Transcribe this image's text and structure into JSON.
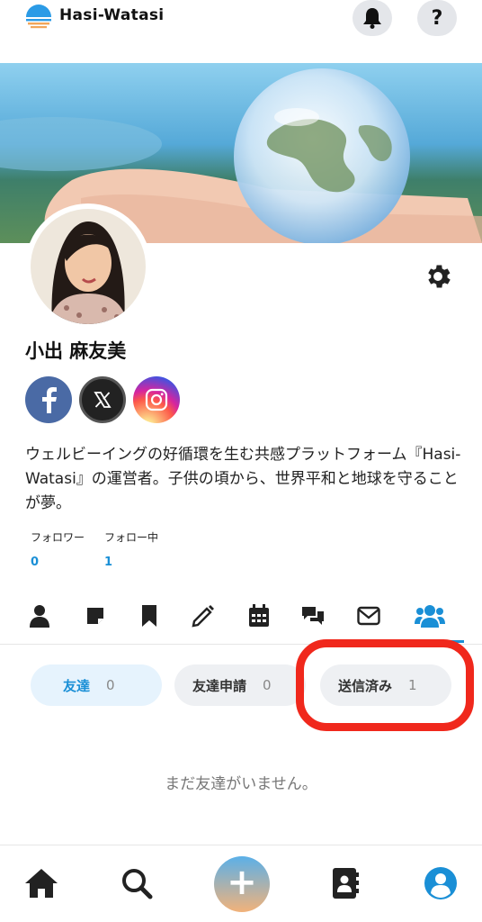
{
  "app": {
    "logo_text": "Hasi-Watasi"
  },
  "header": {
    "help_label": "?"
  },
  "profile": {
    "name": "小出 麻友美",
    "bio": "ウェルビーイングの好循環を生む共感プラットフォーム『Hasi-Watasi』の運営者。子供の頃から、世界平和と地球を守ることが夢。",
    "followers_label": "フォロワー",
    "followers_count": "0",
    "following_label": "フォロー中",
    "following_count": "1",
    "socials": [
      {
        "name": "facebook",
        "glyph": "f"
      },
      {
        "name": "x",
        "glyph": "X"
      },
      {
        "name": "instagram",
        "glyph": ""
      }
    ]
  },
  "tabs": [
    {
      "icon": "person-icon"
    },
    {
      "icon": "sticky-note-icon"
    },
    {
      "icon": "bookmark-icon"
    },
    {
      "icon": "pencil-icon"
    },
    {
      "icon": "calendar-icon"
    },
    {
      "icon": "chat-bubbles-icon"
    },
    {
      "icon": "envelope-icon"
    },
    {
      "icon": "users-icon",
      "active": true
    }
  ],
  "friend_filters": [
    {
      "label": "友達",
      "count": "0",
      "active": true
    },
    {
      "label": "友達申請",
      "count": "0",
      "active": false
    },
    {
      "label": "送信済み",
      "count": "1",
      "active": false,
      "highlighted": true
    }
  ],
  "empty_state": "まだ友達がいません。",
  "bottom_nav": {
    "fab_label": "+",
    "items": [
      "home-icon",
      "search-icon",
      "add-button",
      "contacts-icon",
      "profile-icon"
    ]
  },
  "colors": {
    "accent": "#1a8fd6",
    "highlight": "#f0281c",
    "facebook": "#4a6aa5"
  }
}
